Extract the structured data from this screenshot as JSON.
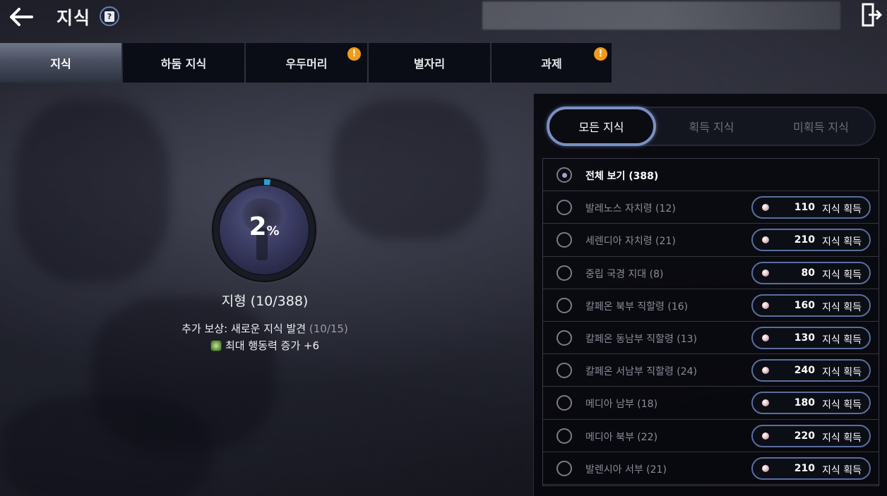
{
  "header": {
    "title": "지식",
    "back_icon": "arrow-left-icon",
    "help_icon": "help-book-icon",
    "exit_icon": "exit-door-icon"
  },
  "tabs": [
    {
      "label": "지식",
      "active": true,
      "alert": false
    },
    {
      "label": "하둠 지식",
      "active": false,
      "alert": false
    },
    {
      "label": "우두머리",
      "active": false,
      "alert": true
    },
    {
      "label": "별자리",
      "active": false,
      "alert": false
    },
    {
      "label": "과제",
      "active": false,
      "alert": true
    }
  ],
  "alert_mark": "!",
  "progress": {
    "percent_value": 2,
    "percent_text": "2",
    "percent_sign": "%",
    "region_label": "지형 (10/388)",
    "reward_text": "추가 보상: 새로운 지식 발견",
    "reward_progress": "(10/15)",
    "reward_effect": "최대 행동력 증가 +6",
    "ring_color": "#2aa0d8"
  },
  "filters": [
    {
      "label": "모든 지식",
      "active": true
    },
    {
      "label": "획득 지식",
      "active": false
    },
    {
      "label": "미획득 지식",
      "active": false
    }
  ],
  "list": {
    "all_label": "전체 보기 (388)",
    "reward_label": "지식 획득",
    "items": [
      {
        "label": "발레노스 자치령 (12)",
        "count": "110"
      },
      {
        "label": "세렌디아 자치령 (21)",
        "count": "210"
      },
      {
        "label": "중립 국경 지대 (8)",
        "count": "80"
      },
      {
        "label": "칼페온 북부 직할령 (16)",
        "count": "160"
      },
      {
        "label": "칼페온 동남부 직할령 (13)",
        "count": "130"
      },
      {
        "label": "칼페온 서남부 직할령 (24)",
        "count": "240"
      },
      {
        "label": "메디아 남부 (18)",
        "count": "180"
      },
      {
        "label": "메디아 북부 (22)",
        "count": "220"
      },
      {
        "label": "발렌시아 서부 (21)",
        "count": "210"
      }
    ]
  },
  "colors": {
    "accent_blue": "#7a8fc4",
    "alert_orange": "#f39a1a",
    "panel_bg": "#07080e"
  }
}
